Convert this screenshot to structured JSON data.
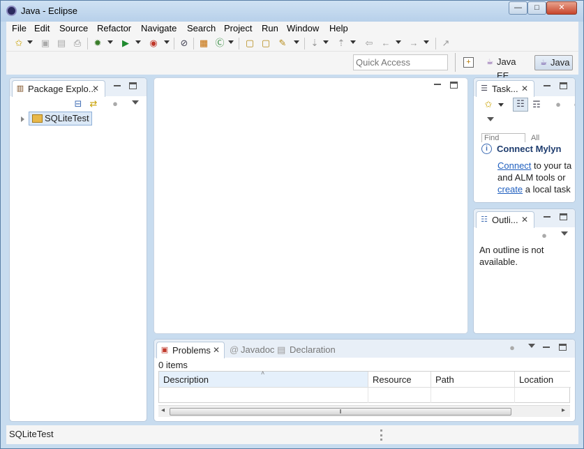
{
  "window": {
    "title": "Java - Eclipse",
    "app_icon": "eclipse-icon",
    "minimize_label": "—",
    "maximize_label": "□",
    "close_label": "✕"
  },
  "menu": {
    "items": [
      "File",
      "Edit",
      "Source",
      "Refactor",
      "Navigate",
      "Search",
      "Project",
      "Run",
      "Window",
      "Help"
    ]
  },
  "perspective_bar": {
    "quick_access_placeholder": "Quick Access",
    "perspectives": [
      {
        "label": "Java EE",
        "active": false
      },
      {
        "label": "Java",
        "active": true
      }
    ]
  },
  "package_explorer": {
    "tab_label": "Package Explo...",
    "tree": [
      {
        "label": "SQLiteTest",
        "selected": true
      }
    ]
  },
  "task_list": {
    "tab_label": "Task...",
    "find_placeholder": "Find",
    "all_label": "All",
    "mylyn": {
      "title": "Connect Mylyn",
      "line1_link": "Connect",
      "line1_rest": "to your ta",
      "line2": "and ALM tools or",
      "line3_link": "create",
      "line3_rest": "a local task"
    }
  },
  "outline": {
    "tab_label": "Outli...",
    "message_line1": "An outline is not",
    "message_line2": "available."
  },
  "bottom_panel": {
    "tabs": [
      {
        "label": "Problems",
        "active": true
      },
      {
        "label": "Javadoc",
        "active": false
      },
      {
        "label": "Declaration",
        "active": false
      }
    ],
    "items_count": "0 items",
    "columns": [
      "Description",
      "Resource",
      "Path",
      "Location"
    ]
  },
  "status_bar": {
    "text": "SQLiteTest"
  },
  "colors": {
    "window_frame": "#c8dcef",
    "link": "#1f5fbf",
    "mylyn_title": "#1e3c6e",
    "selection": "#dbe8f6"
  }
}
